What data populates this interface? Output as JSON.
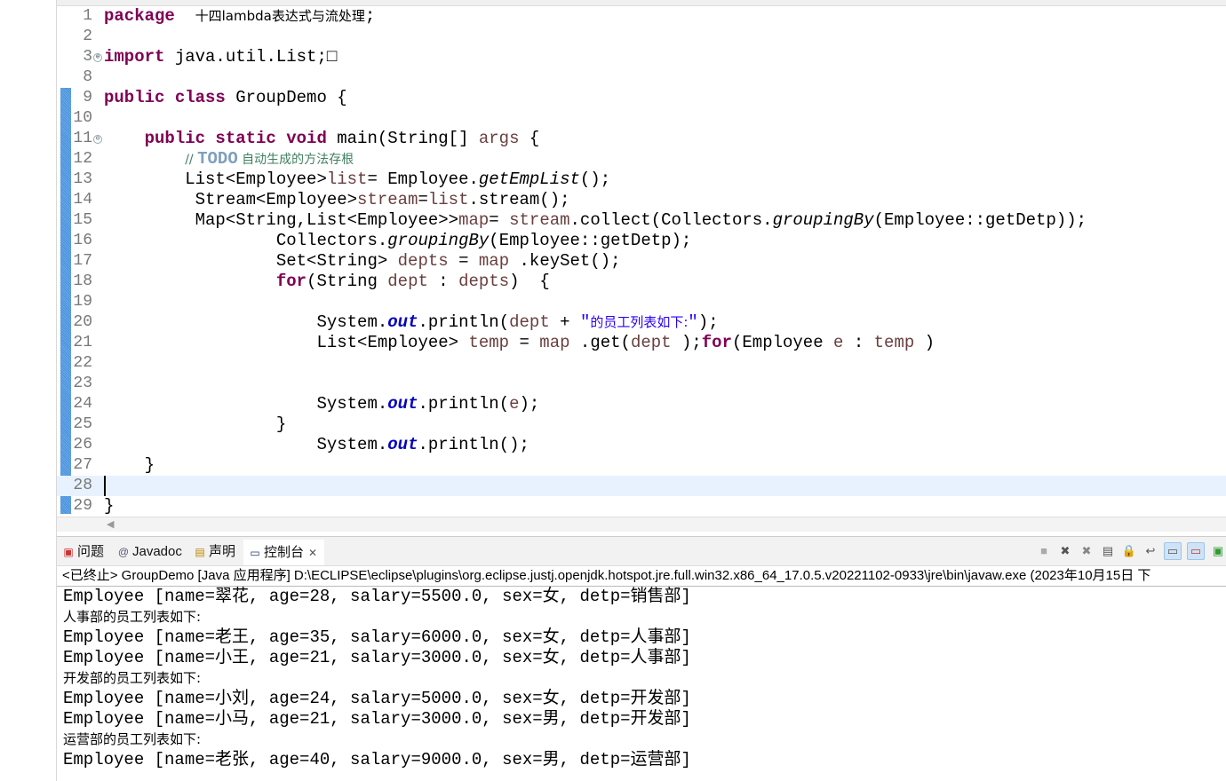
{
  "editor": {
    "lines": [
      {
        "n": "1",
        "t": [
          [
            "kw",
            "package"
          ],
          [
            "",
            "  "
          ],
          [
            "cn",
            "十四lambda表达式与流处理"
          ],
          [
            "",
            ";"
          ]
        ]
      },
      {
        "n": "2",
        "t": []
      },
      {
        "n": "3",
        "fold": "⊕",
        "t": [
          [
            "kw",
            "import"
          ],
          [
            "",
            " java.util.List;"
          ],
          [
            "",
            "□"
          ]
        ]
      },
      {
        "n": "8",
        "t": []
      },
      {
        "n": "9",
        "t": [
          [
            "kw",
            "public class"
          ],
          [
            "",
            " GroupDemo {"
          ]
        ]
      },
      {
        "n": "10",
        "t": []
      },
      {
        "n": "11",
        "fold": "⊖",
        "t": [
          [
            "",
            "    "
          ],
          [
            "kw",
            "public static void"
          ],
          [
            "",
            " main(String[] "
          ],
          [
            "var",
            "args"
          ],
          [
            "",
            " {"
          ]
        ]
      },
      {
        "n": "12",
        "t": [
          [
            "",
            "        "
          ],
          [
            "cmt",
            "// "
          ],
          [
            "todo",
            "TODO"
          ],
          [
            "cmt",
            " 自动生成的方法存根"
          ]
        ]
      },
      {
        "n": "13",
        "t": [
          [
            "",
            "        List<Employee>"
          ],
          [
            "var",
            "list"
          ],
          [
            "",
            "= Employee."
          ],
          [
            "it",
            "getEmpList"
          ],
          [
            "",
            "();"
          ]
        ]
      },
      {
        "n": "14",
        "t": [
          [
            "",
            "         Stream<Employee>"
          ],
          [
            "var",
            "stream"
          ],
          [
            "",
            "="
          ],
          [
            "var",
            "list"
          ],
          [
            "",
            ".stream();"
          ]
        ]
      },
      {
        "n": "15",
        "t": [
          [
            "",
            "         Map<String,List<Employee>>"
          ],
          [
            "var",
            "map"
          ],
          [
            "",
            "= "
          ],
          [
            "var",
            "stream"
          ],
          [
            "",
            ".collect(Collectors."
          ],
          [
            "it",
            "groupingBy"
          ],
          [
            "",
            "(Employee::getDetp));"
          ]
        ]
      },
      {
        "n": "16",
        "t": [
          [
            "",
            "                 Collectors."
          ],
          [
            "it",
            "groupingBy"
          ],
          [
            "",
            "(Employee::getDetp);"
          ]
        ]
      },
      {
        "n": "17",
        "t": [
          [
            "",
            "                 Set<String> "
          ],
          [
            "var",
            "depts"
          ],
          [
            "",
            " = "
          ],
          [
            "var",
            "map"
          ],
          [
            "",
            " .keySet();"
          ]
        ]
      },
      {
        "n": "18",
        "t": [
          [
            "",
            "                 "
          ],
          [
            "kw",
            "for"
          ],
          [
            "",
            "(String "
          ],
          [
            "var",
            "dept"
          ],
          [
            "",
            " : "
          ],
          [
            "var",
            "depts"
          ],
          [
            "",
            ")  {"
          ]
        ]
      },
      {
        "n": "19",
        "t": []
      },
      {
        "n": "20",
        "t": [
          [
            "",
            "                     System."
          ],
          [
            "fld",
            "out"
          ],
          [
            "",
            ".println("
          ],
          [
            "var",
            "dept"
          ],
          [
            "",
            " + "
          ],
          [
            "str",
            "\""
          ],
          [
            "str cn",
            "的员工列表如下:"
          ],
          [
            "str",
            "\""
          ],
          [
            "",
            ");"
          ]
        ]
      },
      {
        "n": "21",
        "t": [
          [
            "",
            "                     List<Employee> "
          ],
          [
            "var",
            "temp"
          ],
          [
            "",
            " = "
          ],
          [
            "var",
            "map"
          ],
          [
            "",
            " .get("
          ],
          [
            "var",
            "dept"
          ],
          [
            "",
            " );"
          ],
          [
            "kw",
            "for"
          ],
          [
            "",
            "(Employee "
          ],
          [
            "var",
            "e"
          ],
          [
            "",
            " : "
          ],
          [
            "var",
            "temp"
          ],
          [
            "",
            " )"
          ]
        ]
      },
      {
        "n": "22",
        "t": []
      },
      {
        "n": "23",
        "t": []
      },
      {
        "n": "24",
        "t": [
          [
            "",
            "                     System."
          ],
          [
            "fld",
            "out"
          ],
          [
            "",
            ".println("
          ],
          [
            "var",
            "e"
          ],
          [
            "",
            ");"
          ]
        ]
      },
      {
        "n": "25",
        "t": [
          [
            "",
            "                 }"
          ]
        ]
      },
      {
        "n": "26",
        "t": [
          [
            "",
            "                     System."
          ],
          [
            "fld",
            "out"
          ],
          [
            "",
            ".println();"
          ]
        ]
      },
      {
        "n": "27",
        "t": [
          [
            "",
            "    }"
          ]
        ]
      },
      {
        "n": "28",
        "cur": true,
        "t": []
      },
      {
        "n": "29",
        "t": [
          [
            "",
            "}"
          ]
        ]
      }
    ]
  },
  "console": {
    "tabs": [
      {
        "icon": "problems-icon",
        "label": "问题"
      },
      {
        "icon": "at-icon",
        "label": "Javadoc"
      },
      {
        "icon": "declaration-icon",
        "label": "声明"
      },
      {
        "icon": "console-icon",
        "label": "控制台"
      }
    ],
    "status": "<已终止> GroupDemo [Java 应用程序] D:\\ECLIPSE\\eclipse\\plugins\\org.eclipse.justj.openjdk.hotspot.jre.full.win32.x86_64_17.0.5.v20221102-0933\\jre\\bin\\javaw.exe  (2023年10月15日 下",
    "output": [
      "Employee [name=翠花, age=28, salary=5500.0, sex=女, detp=销售部]",
      "人事部的员工列表如下:",
      "Employee [name=老王, age=35, salary=6000.0, sex=女, detp=人事部]",
      "Employee [name=小王, age=21, salary=3000.0, sex=女, detp=人事部]",
      "开发部的员工列表如下:",
      "Employee [name=小刘, age=24, salary=5000.0, sex=女, detp=开发部]",
      "Employee [name=小马, age=21, salary=3000.0, sex=男, detp=开发部]",
      "运营部的员工列表如下:",
      "Employee [name=老张, age=40, salary=9000.0, sex=男, detp=运营部]"
    ]
  }
}
